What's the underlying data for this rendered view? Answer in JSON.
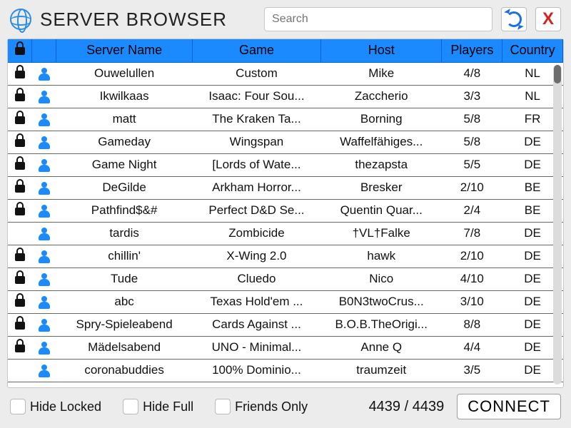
{
  "header": {
    "title": "SERVER BROWSER",
    "search_placeholder": "Search"
  },
  "columns": {
    "lock": "",
    "friend": "",
    "name": "Server Name",
    "game": "Game",
    "host": "Host",
    "players": "Players",
    "country": "Country"
  },
  "rows": [
    {
      "locked": true,
      "friend": true,
      "name": "Ouwelullen",
      "game": "Custom",
      "host": "Mike",
      "players": "4/8",
      "country": "NL"
    },
    {
      "locked": true,
      "friend": true,
      "name": "Ikwilkaas",
      "game": "Isaac: Four Sou...",
      "host": "Zaccherio",
      "players": "3/3",
      "country": "NL"
    },
    {
      "locked": true,
      "friend": true,
      "name": "matt",
      "game": "The Kraken Ta...",
      "host": "Borning",
      "players": "5/8",
      "country": "FR"
    },
    {
      "locked": true,
      "friend": true,
      "name": "Gameday",
      "game": "Wingspan",
      "host": "Waffelfähiges...",
      "players": "5/8",
      "country": "DE"
    },
    {
      "locked": true,
      "friend": true,
      "name": "Game Night",
      "game": "[Lords of Wate...",
      "host": "thezapsta",
      "players": "5/5",
      "country": "DE"
    },
    {
      "locked": true,
      "friend": true,
      "name": "DeGilde",
      "game": "Arkham Horror...",
      "host": "Bresker",
      "players": "2/10",
      "country": "BE"
    },
    {
      "locked": true,
      "friend": true,
      "name": "Pathfind$&#",
      "game": "Perfect D&D Se...",
      "host": "Quentin Quar...",
      "players": "2/4",
      "country": "BE"
    },
    {
      "locked": false,
      "friend": true,
      "name": "tardis",
      "game": "Zombicide",
      "host": "†VL†Falke",
      "players": "7/8",
      "country": "DE"
    },
    {
      "locked": true,
      "friend": true,
      "name": "chillin'",
      "game": "X-Wing 2.0",
      "host": "hawk",
      "players": "2/10",
      "country": "DE"
    },
    {
      "locked": true,
      "friend": true,
      "name": "Tude",
      "game": "Cluedo",
      "host": "Nico",
      "players": "4/10",
      "country": "DE"
    },
    {
      "locked": true,
      "friend": true,
      "name": "abc",
      "game": "Texas Hold'em ...",
      "host": "B0N3twoCrus...",
      "players": "3/10",
      "country": "DE"
    },
    {
      "locked": true,
      "friend": true,
      "name": "Spry-Spieleabend",
      "game": "Cards Against ...",
      "host": "B.O.B.TheOrigi...",
      "players": "8/8",
      "country": "DE"
    },
    {
      "locked": true,
      "friend": true,
      "name": "Mädelsabend",
      "game": "UNO - Minimal...",
      "host": "Anne Q",
      "players": "4/4",
      "country": "DE"
    },
    {
      "locked": false,
      "friend": true,
      "name": "coronabuddies",
      "game": "100% Dominio...",
      "host": "traumzeit",
      "players": "3/5",
      "country": "DE"
    }
  ],
  "footer": {
    "hide_locked": "Hide Locked",
    "hide_full": "Hide Full",
    "friends_only": "Friends Only",
    "count": "4439 / 4439",
    "connect": "CONNECT"
  }
}
